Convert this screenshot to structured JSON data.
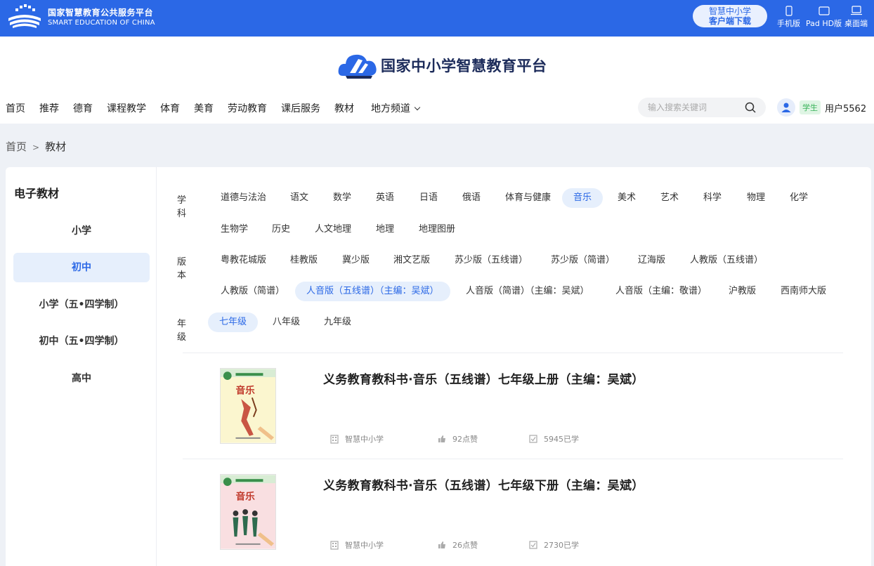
{
  "topbar": {
    "brand_cn": "国家智慧教育公共服务平台",
    "brand_en": "SMART EDUCATION OF CHINA",
    "download_line1": "智慧中小学",
    "download_line2": "客户端下载",
    "devices": [
      "手机版",
      "Pad HD版",
      "桌面端"
    ]
  },
  "header": {
    "logo_text": "国家中小学智慧教育平台",
    "nav": [
      "首页",
      "推荐",
      "德育",
      "课程教学",
      "体育",
      "美育",
      "劳动教育",
      "课后服务",
      "教材",
      "地方频道"
    ],
    "search_placeholder": "输入搜索关键词",
    "role": "学生",
    "username": "用户5562"
  },
  "breadcrumb": {
    "home": "首页",
    "sep": ">",
    "current": "教材"
  },
  "sidebar": {
    "title": "电子教材",
    "items": [
      "小学",
      "初中",
      "小学（五•四学制）",
      "初中（五•四学制）",
      "高中"
    ],
    "active_index": 1
  },
  "filters": {
    "subject_label": "学科",
    "subjects": [
      "道德与法治",
      "语文",
      "数学",
      "英语",
      "日语",
      "俄语",
      "体育与健康",
      "音乐",
      "美术",
      "艺术",
      "科学",
      "物理",
      "化学",
      "生物学",
      "历史",
      "人文地理",
      "地理",
      "地理图册"
    ],
    "subject_active": "音乐",
    "edition_label": "版本",
    "editions": [
      "粤教花城版",
      "桂教版",
      "冀少版",
      "湘文艺版",
      "苏少版（五线谱）",
      "苏少版（简谱）",
      "辽海版",
      "人教版（五线谱）",
      "人教版（简谱）",
      "人音版（五线谱）（主编：吴斌）",
      "人音版（简谱）（主编：吴斌）",
      "人音版（主编：敬谱）",
      "沪教版",
      "西南师大版"
    ],
    "edition_active": "人音版（五线谱）（主编：吴斌）",
    "grade_label": "年级",
    "grades": [
      "七年级",
      "八年级",
      "九年级"
    ],
    "grade_active": "七年级"
  },
  "books": [
    {
      "title": "义务教育教科书·音乐（五线谱）七年级上册（主编：吴斌）",
      "cover_title": "音乐",
      "source": "智慧中小学",
      "likes": "92点赞",
      "learners": "5945已学",
      "cover_bg": "#fbf6cf"
    },
    {
      "title": "义务教育教科书·音乐（五线谱）七年级下册（主编：吴斌）",
      "cover_title": "音乐",
      "source": "智慧中小学",
      "likes": "26点赞",
      "learners": "2730已学",
      "cover_bg": "#f9dfe1"
    }
  ],
  "colors": {
    "brand_blue": "#2b68e6",
    "active_bg": "#e6effc",
    "role_green": "#39b35a"
  }
}
